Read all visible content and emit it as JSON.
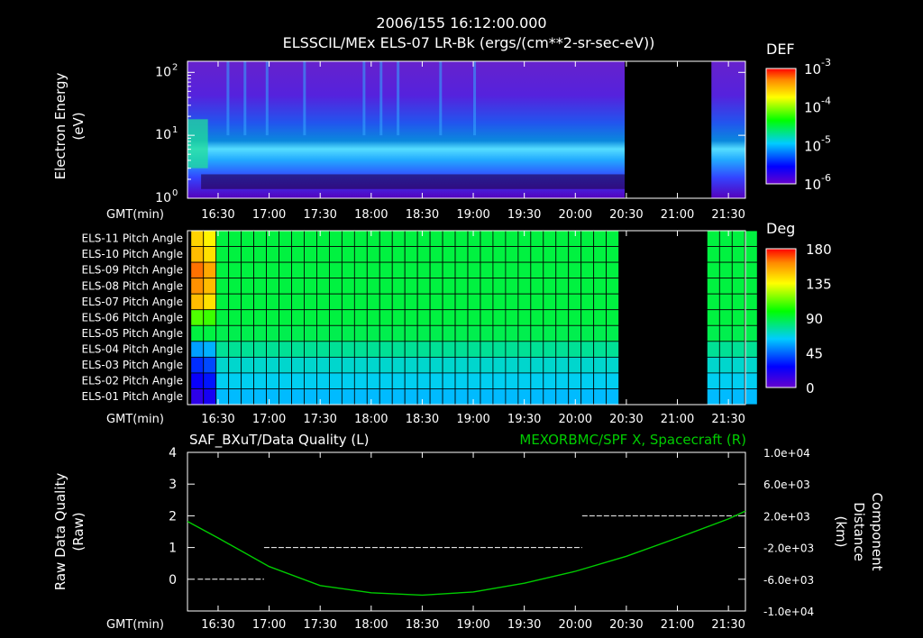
{
  "header": {
    "timestamp": "2006/155 16:12:00.000",
    "title": "ELSSCIL/MEx ELS-07 LR-Bk  (ergs/(cm**2-sr-sec-eV))"
  },
  "time_axis": {
    "label": "GMT(min)",
    "ticks": [
      "16:30",
      "17:00",
      "17:30",
      "18:00",
      "18:30",
      "19:00",
      "19:30",
      "20:00",
      "20:30",
      "21:00",
      "21:30"
    ]
  },
  "colors": {
    "accent_green": "#00cc00"
  },
  "chart_data": [
    {
      "type": "heatmap",
      "name": "spectrogram",
      "ylabel_line1": "Electron Energy",
      "ylabel_line2": "(eV)",
      "y_scale": "log",
      "ylim": [
        1,
        150
      ],
      "y_ticks": [
        {
          "base": "10",
          "exp": "2",
          "value": 100
        },
        {
          "base": "10",
          "exp": "1",
          "value": 10
        },
        {
          "base": "10",
          "exp": "0",
          "value": 1
        }
      ],
      "x_range": [
        "16:12",
        "21:40"
      ],
      "data_gap": [
        "20:29",
        "21:20"
      ],
      "colorbar": {
        "label": "DEF",
        "scale": "log",
        "ticks": [
          {
            "base": "10",
            "exp": "-3"
          },
          {
            "base": "10",
            "exp": "-4"
          },
          {
            "base": "10",
            "exp": "-5"
          },
          {
            "base": "10",
            "exp": "-6"
          }
        ]
      }
    },
    {
      "type": "heatmap",
      "name": "pitch_angle",
      "rows": [
        "ELS-11 Pitch Angle",
        "ELS-10 Pitch Angle",
        "ELS-09 Pitch Angle",
        "ELS-08 Pitch Angle",
        "ELS-07 Pitch Angle",
        "ELS-06 Pitch Angle",
        "ELS-05 Pitch Angle",
        "ELS-04 Pitch Angle",
        "ELS-03 Pitch Angle",
        "ELS-02 Pitch Angle",
        "ELS-01 Pitch Angle"
      ],
      "early_values_deg": [
        145,
        150,
        165,
        160,
        150,
        110,
        90,
        55,
        35,
        25,
        15
      ],
      "steady_values_deg": [
        90,
        90,
        90,
        90,
        90,
        90,
        88,
        78,
        70,
        65,
        60
      ],
      "data_gap": [
        "20:29",
        "21:20"
      ],
      "colorbar": {
        "label": "Deg",
        "range": [
          0,
          180
        ],
        "ticks": [
          "180",
          "135",
          "90",
          "45",
          "0"
        ]
      }
    },
    {
      "type": "line",
      "name": "data_quality",
      "title_left": "SAF_BXuT/Data Quality (L)",
      "title_right": "MEXORBMC/SPF X, Spacecraft (R)",
      "ylabel_left_line1": "Raw Data Quality",
      "ylabel_left_line2": "(Raw)",
      "ylabel_right_line1": "Component",
      "ylabel_right_line2": "Distance",
      "ylabel_right_line3": "(km)",
      "ylim_left": [
        -1,
        4
      ],
      "yticks_left": [
        "4",
        "3",
        "2",
        "1",
        "0"
      ],
      "ylim_right": [
        -10000,
        10000
      ],
      "yticks_right": [
        "1.0e+04",
        "6.0e+03",
        "2.0e+03",
        "-2.0e+03",
        "-6.0e+03",
        "-1.0e+04"
      ],
      "series": [
        {
          "name": "SAF_BXuT/Data Quality",
          "axis": "left",
          "color": "#ffffff",
          "segments": [
            {
              "x_start": "16:18",
              "x_end": "16:57",
              "y": 0
            },
            {
              "x_start": "16:57",
              "x_end": "20:04",
              "y": 1
            },
            {
              "x_start": "20:04",
              "x_end": "21:35",
              "y": 2
            }
          ]
        },
        {
          "name": "MEXORBMC/SPF X, Spacecraft",
          "axis": "right",
          "color": "#00cc00",
          "x": [
            "16:12",
            "16:30",
            "17:00",
            "17:30",
            "18:00",
            "18:30",
            "19:00",
            "19:30",
            "20:00",
            "20:30",
            "21:00",
            "21:30",
            "21:40"
          ],
          "y": [
            1300,
            -800,
            -4400,
            -6800,
            -7700,
            -8000,
            -7600,
            -6500,
            -5000,
            -3100,
            -800,
            1600,
            2600
          ]
        }
      ]
    }
  ]
}
